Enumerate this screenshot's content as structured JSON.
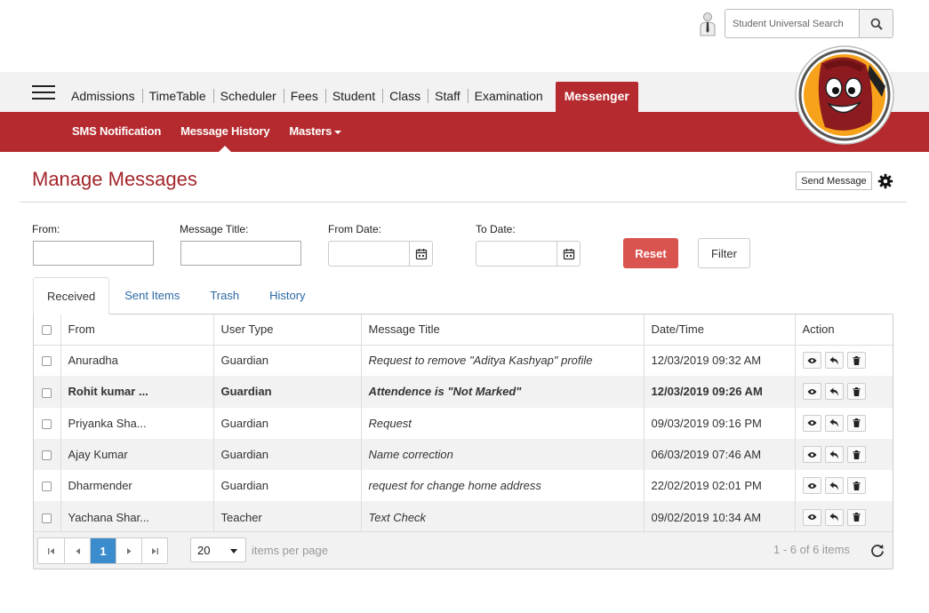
{
  "search": {
    "placeholder": "Student Universal Search"
  },
  "main_nav": {
    "items": [
      "Admissions",
      "TimeTable",
      "Scheduler",
      "Fees",
      "Student",
      "Class",
      "Staff",
      "Examination"
    ],
    "active": "Messenger"
  },
  "sub_nav": {
    "sms": "SMS Notification",
    "history": "Message History",
    "masters": "Masters"
  },
  "page": {
    "title": "Manage Messages",
    "send_message": "Send Message"
  },
  "filters": {
    "from_label": "From:",
    "title_label": "Message Title:",
    "from_date_label": "From Date:",
    "to_date_label": "To Date:",
    "from_value": "",
    "title_value": "",
    "reset": "Reset",
    "filter": "Filter"
  },
  "tabs": [
    "Received",
    "Sent Items",
    "Trash",
    "History"
  ],
  "table": {
    "headers": {
      "from": "From",
      "user_type": "User Type",
      "title": "Message Title",
      "datetime": "Date/Time",
      "action": "Action"
    },
    "rows": [
      {
        "from": "Anuradha",
        "user_type": "Guardian",
        "title": "Request to remove \"Aditya Kashyap\" profile",
        "datetime": "12/03/2019 09:32 AM"
      },
      {
        "from": "Rohit kumar ...",
        "user_type": "Guardian",
        "title": "Attendence is \"Not Marked\"",
        "datetime": "12/03/2019 09:26 AM"
      },
      {
        "from": "Priyanka Sha...",
        "user_type": "Guardian",
        "title": "Request",
        "datetime": "09/03/2019 09:16 PM"
      },
      {
        "from": "Ajay Kumar",
        "user_type": "Guardian",
        "title": "Name correction",
        "datetime": "06/03/2019 07:46 AM"
      },
      {
        "from": "Dharmender",
        "user_type": "Guardian",
        "title": "request for change home address",
        "datetime": "22/02/2019 02:01 PM"
      },
      {
        "from": "Yachana Shar...",
        "user_type": "Teacher",
        "title": "Text Check",
        "datetime": "09/02/2019 10:34 AM"
      }
    ]
  },
  "pager": {
    "current_page": "1",
    "page_size": "20",
    "per_page_label": "items per page",
    "info": "1 - 6 of 6 items"
  },
  "colors": {
    "brand": "#b52a2f",
    "title": "#a3262b",
    "reset": "#d9534f",
    "link": "#2b6aa5",
    "pager_active": "#3b8ccc"
  },
  "icons": [
    "user-icon",
    "search-icon",
    "menu-icon",
    "gear-icon",
    "calendar-icon",
    "view-icon",
    "reply-icon",
    "delete-icon",
    "first-page-icon",
    "prev-page-icon",
    "next-page-icon",
    "last-page-icon",
    "refresh-icon"
  ]
}
